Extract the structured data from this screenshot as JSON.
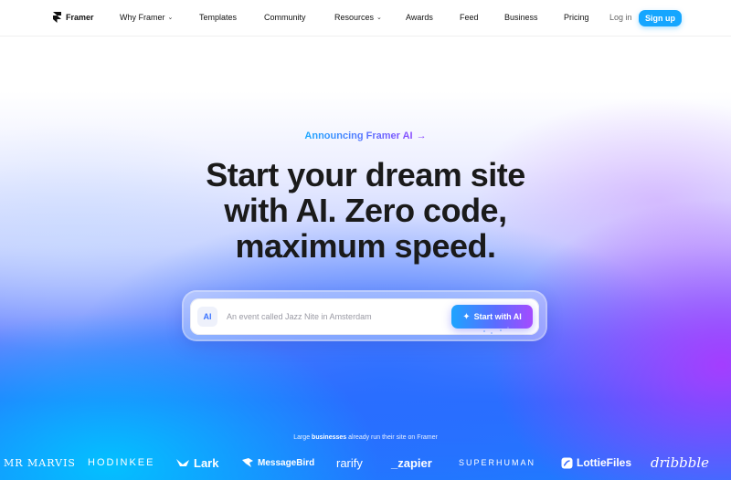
{
  "nav": {
    "brand": "Framer",
    "links": [
      {
        "label": "Why Framer",
        "dropdown": true
      },
      {
        "label": "Templates",
        "dropdown": false
      },
      {
        "label": "Community",
        "dropdown": false
      },
      {
        "label": "Resources",
        "dropdown": true
      },
      {
        "label": "Awards",
        "dropdown": false
      },
      {
        "label": "Feed",
        "dropdown": false
      },
      {
        "label": "Business",
        "dropdown": false
      },
      {
        "label": "Pricing",
        "dropdown": false
      }
    ],
    "login": "Log in",
    "signup": "Sign up"
  },
  "hero": {
    "announcement": "Announcing Framer AI",
    "announcement_arrow": "→",
    "headline_lines": [
      "Start your dream site",
      "with AI. Zero code,",
      "maximum speed."
    ],
    "prompt": {
      "badge": "AI",
      "placeholder": "An event called Jazz Nite in Amsterdam",
      "button": "Start with AI"
    }
  },
  "businesses": {
    "caption_prefix": "Large",
    "caption_bold": "businesses",
    "caption_suffix": "already run their site on Framer",
    "logos": [
      "MR MARVIS",
      "HODINKEE",
      "Lark",
      "MessageBird",
      "rarify",
      "_zapier",
      "SUPERHUMAN",
      "LottieFiles",
      "dribbble"
    ]
  },
  "colors": {
    "accent_blue": "#15a6ff",
    "accent_purple": "#a54bff",
    "headline": "#1a1a1a"
  },
  "icons": {
    "brand": "framer-logo-icon",
    "sparkle": "sparkle-icon",
    "arrow": "arrow-right-icon",
    "chevron": "chevron-down-icon"
  }
}
